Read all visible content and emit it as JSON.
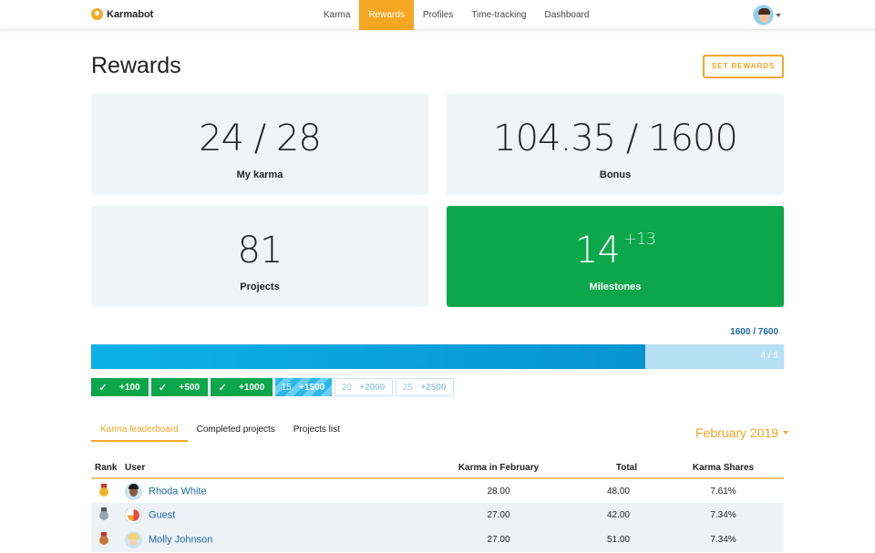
{
  "brand": {
    "name": "Karmabot"
  },
  "nav": [
    {
      "label": "Karma",
      "active": false
    },
    {
      "label": "Rewards",
      "active": true
    },
    {
      "label": "Profiles",
      "active": false
    },
    {
      "label": "Time-tracking",
      "active": false
    },
    {
      "label": "Dashboard",
      "active": false
    }
  ],
  "page": {
    "title": "Rewards",
    "set_rewards_label": "SET REWARDS"
  },
  "stats": {
    "my_karma": {
      "value": "24 / 28",
      "label": "My karma"
    },
    "bonus": {
      "value": "104.35 / 1600",
      "label": "Bonus"
    },
    "projects": {
      "value": "81",
      "label": "Projects"
    },
    "milestones": {
      "value": "14",
      "delta": "+13",
      "label": "Milestones"
    }
  },
  "progress": {
    "label": "1600 / 7600",
    "count": "4 / 5",
    "fraction": 0.8
  },
  "milestone_steps": [
    {
      "num": "",
      "amount": "+100",
      "state": "done"
    },
    {
      "num": "",
      "amount": "+500",
      "state": "done"
    },
    {
      "num": "",
      "amount": "+1000",
      "state": "done"
    },
    {
      "num": "15",
      "amount": "+1500",
      "state": "progress"
    },
    {
      "num": "20",
      "amount": "+2000",
      "state": "todo"
    },
    {
      "num": "25",
      "amount": "+2500",
      "state": "todo"
    }
  ],
  "tabs": [
    {
      "label": "Karma leaderboard",
      "active": true
    },
    {
      "label": "Completed projects",
      "active": false
    },
    {
      "label": "Projects list",
      "active": false
    }
  ],
  "month_selector": "February 2019",
  "table": {
    "headers": {
      "rank": "Rank",
      "user": "User",
      "karma": "Karma in February",
      "total": "Total",
      "shares": "Karma Shares"
    },
    "rows": [
      {
        "medal": "gold",
        "medal_color": "#f0b429",
        "name": "Rhoda White",
        "karma": "28.00",
        "total": "48.00",
        "shares": "7.61%"
      },
      {
        "medal": "silver",
        "medal_color": "#9aa3ad",
        "name": "Guest",
        "karma": "27.00",
        "total": "42.00",
        "shares": "7.34%"
      },
      {
        "medal": "bronze",
        "medal_color": "#c8743a",
        "name": "Molly Johnson",
        "karma": "27.00",
        "total": "51.00",
        "shares": "7.34%"
      }
    ]
  },
  "colors": {
    "accent": "#f5a623",
    "success": "#0ca74a",
    "progress": "#0db1e8",
    "link": "#1c6aa6"
  }
}
